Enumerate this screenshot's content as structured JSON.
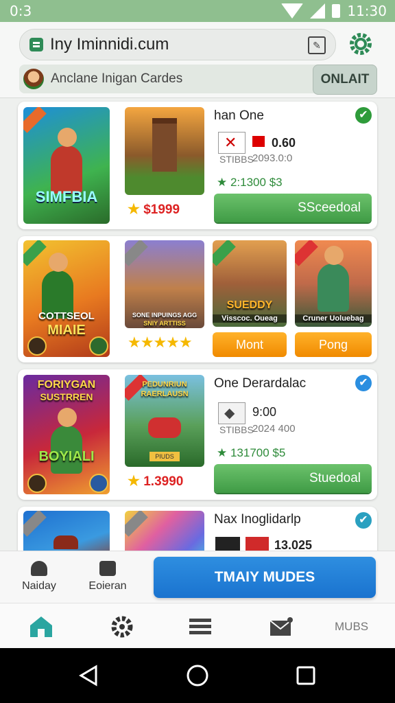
{
  "status_bar": {
    "time_left": "0:3",
    "time_right": "11:30"
  },
  "browser": {
    "url": "Iny Iminnidi.cum",
    "site_title": "Anclane Inigan Cardes",
    "online_label": "ONLAIT"
  },
  "cards": [
    {
      "cover_title": "SIMFBIA",
      "price": "$1999",
      "title": "han One",
      "meta_value": "0.60",
      "meta_small": "STIBBS",
      "meta_sub": "2093.0:0",
      "stat": "2:1300 $3",
      "button": "SSceedoal",
      "check_color": "#2e9b3a"
    },
    {
      "cover_title_1": "COTTSEOL",
      "cover_title_2": "MIAIE",
      "thumb2_caption_1": "SONE INPUINGS AGG",
      "thumb2_caption_2": "SNIY ARTTISS",
      "thumb3_title": "SUEDDY",
      "thumb3_caption": "Visscoc. Oueag",
      "thumb4_caption": "Cruner Uoluebag",
      "button_1": "Mont",
      "button_2": "Pong"
    },
    {
      "cover_title_1": "FORIYGAN",
      "cover_title_2": "SUSTRREN",
      "cover_title_3": "BOYIALI",
      "thumb2_caption_1": "PEDUNRIUN",
      "thumb2_caption_2": "RAERLAUSN",
      "thumb2_tag": "PIUDS",
      "price": "1.3990",
      "title": "One Derardalac",
      "meta_value": "9:00",
      "meta_small": "STIBBS",
      "meta_sub": "2024 400",
      "stat": "131700 $5",
      "button": "Stuedoal",
      "check_color": "#2a8ee0"
    },
    {
      "title": "Nax Inoglidarlp",
      "meta_value": "13.025",
      "check_color": "#2aa0c0"
    }
  ],
  "bottom_actions": {
    "item1": "Naiday",
    "item2": "Eoieran",
    "main_button": "TMAIY MUDES"
  },
  "nav": {
    "item5": "MUBS"
  },
  "icons": [
    "wifi-icon",
    "signal-icon",
    "battery-icon",
    "tab-icon",
    "edit-icon",
    "settings-icon",
    "home-icon",
    "gear-icon",
    "list-icon",
    "mail-icon",
    "back-icon",
    "home-circle-icon",
    "recents-icon",
    "check-icon",
    "star-icon"
  ]
}
